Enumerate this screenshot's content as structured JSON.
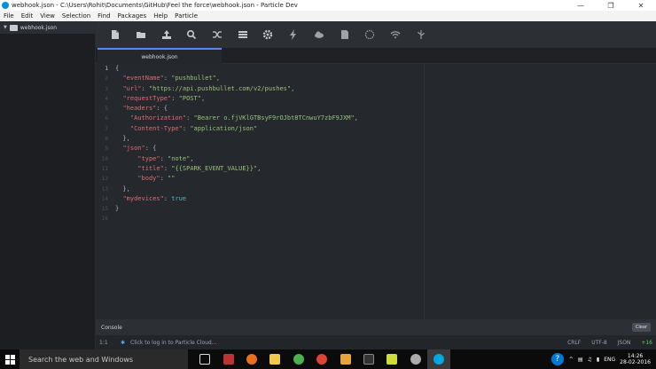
{
  "window": {
    "title": "webhook.json - C:\\Users\\Rohit\\Documents\\GitHub\\Feel the force\\webhook.json - Particle Dev",
    "controls": [
      "—",
      "❐",
      "✕"
    ]
  },
  "menu": [
    "File",
    "Edit",
    "View",
    "Selection",
    "Find",
    "Packages",
    "Help",
    "Particle"
  ],
  "sidebar": {
    "root_label": "webhook.json"
  },
  "toolbar": {
    "icons": [
      "new-file-icon",
      "open-folder-icon",
      "upload-icon",
      "search-icon",
      "shuffle-icon",
      "list-icon",
      "gear-icon",
      "flash-icon",
      "cloud-icon",
      "document-icon",
      "target-icon",
      "wifi-icon",
      "usb-icon"
    ]
  },
  "tab": {
    "label": "webhook.json"
  },
  "editor": {
    "line_numbers": [
      "1",
      "2",
      "3",
      "4",
      "5",
      "6",
      "7",
      "8",
      "9",
      "10",
      "11",
      "12",
      "13",
      "14",
      "15",
      "16"
    ],
    "active_line": 1
  },
  "console": {
    "label": "Console",
    "clear_label": "Clear"
  },
  "status": {
    "position": "1:1",
    "message": "Click to log in to Particle Cloud...",
    "line_ending": "CRLF",
    "encoding": "UTF-8",
    "grammar": "JSON",
    "git": "+16"
  },
  "taskbar": {
    "search_placeholder": "Search the web and Windows",
    "help": "?",
    "tray_chevron": "^",
    "language": "ENG",
    "time": "14:26",
    "date": "28-02-2016"
  },
  "colors": {
    "accent": "#568af2",
    "key": "#e06c75",
    "string": "#98c379",
    "bool": "#56b6c2"
  }
}
